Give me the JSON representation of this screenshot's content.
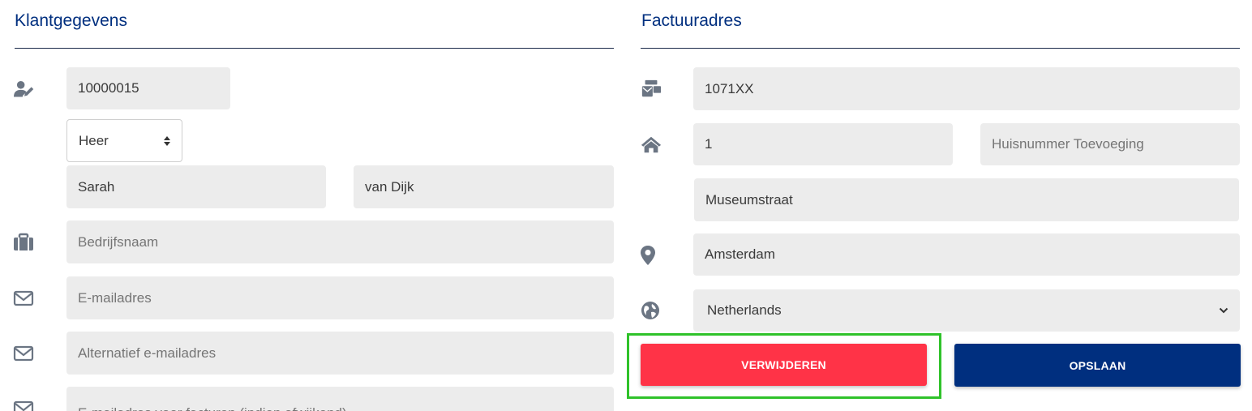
{
  "customer": {
    "title": "Klantgegevens",
    "customer_number": "10000015",
    "salutation": "Heer",
    "first_name": "Sarah",
    "last_name": "van Dijk",
    "company_placeholder": "Bedrijfsnaam",
    "email_placeholder": "E-mailadres",
    "alt_email_placeholder": "Alternatief e-mailadres",
    "invoice_email_placeholder": "E-mailadres voor facturen (indien afwijkend)"
  },
  "billing": {
    "title": "Factuuradres",
    "postcode": "1071XX",
    "house_number": "1",
    "house_number_addition_placeholder": "Huisnummer Toevoeging",
    "street": "Museumstraat",
    "city": "Amsterdam",
    "country": "Netherlands"
  },
  "actions": {
    "delete_label": "VERWIJDEREN",
    "save_label": "OPSLAAN"
  },
  "colors": {
    "accent": "#002f7f",
    "danger": "#ff3347",
    "highlight": "#2fc22a",
    "icon": "#6b7583"
  },
  "icons": {
    "customer_number": "user-edit-icon",
    "company": "briefcase-icon",
    "email": "envelope-icon",
    "alt_email": "envelope-icon",
    "invoice_email": "envelope-icon",
    "postcode": "mail-bulk-icon",
    "house": "home-icon",
    "city": "map-marker-icon",
    "country": "globe-icon"
  }
}
